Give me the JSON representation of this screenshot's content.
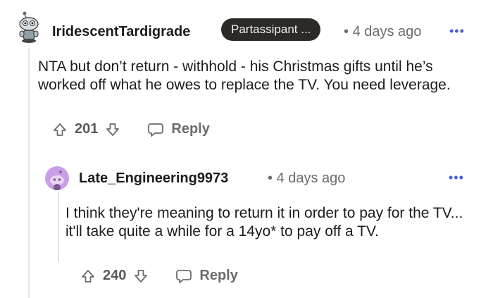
{
  "comments": [
    {
      "username": "IridescentTardigrade",
      "flair": "Partassipant ...",
      "separator": "•",
      "time": "4 days ago",
      "more": "•••",
      "body": "NTA but don’t return - withhold - his Christmas gifts until he’s worked off what he owes to replace the TV. You need leverage.",
      "votes": "201",
      "reply_label": "Reply",
      "avatar_icon": "snoo-avatar-icon"
    },
    {
      "username": "Late_Engineering9973",
      "separator": "•",
      "time": "4 days ago",
      "more": "•••",
      "body": "I think they're meaning to return it in order to pay for the TV... it'll take quite a while for a 14yo* to pay off a TV.",
      "votes": "240",
      "reply_label": "Reply",
      "avatar_icon": "default-snoo-avatar-icon"
    }
  ],
  "colors": {
    "text": "#1c1c1c",
    "meta": "#6b6b6b",
    "flair_bg": "#2c2a26",
    "more_dots": "#4a5fd0",
    "thread_line": "#e3e3e3",
    "avatar2_bg": "#c99ee6"
  }
}
